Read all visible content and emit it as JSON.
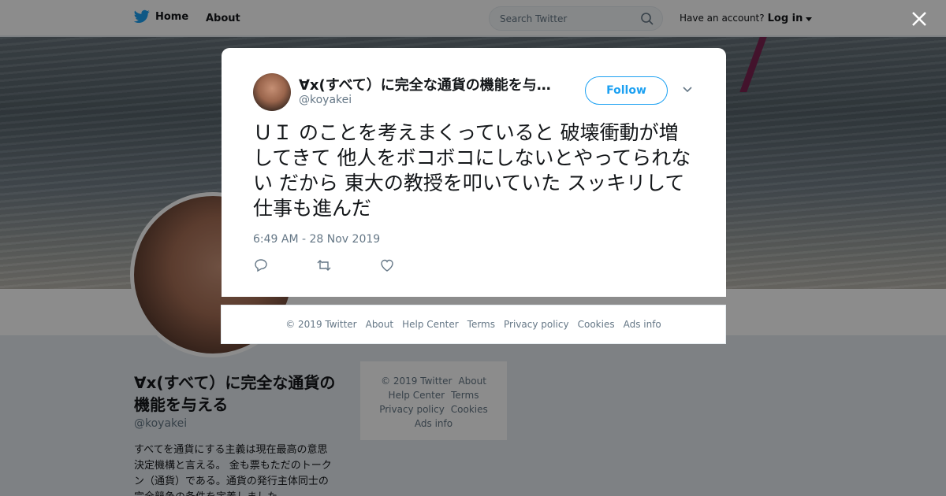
{
  "nav": {
    "home_label": "Home",
    "about_label": "About"
  },
  "search": {
    "placeholder": "Search Twitter"
  },
  "account": {
    "prompt": "Have an account?",
    "login_label": "Log in"
  },
  "profile": {
    "name": "∀x(すべて）に完全な通貨の機能を与える",
    "handle": "@koyakei",
    "bio": "すべてを通貨にする主義は現在最高の意思決定機構と言える。 金も票もただのトークン（通貨）である。通貨の発行主体同士の完全競争の条件を定義しました"
  },
  "side_footer": {
    "line1": [
      "© 2019 Twitter",
      "About"
    ],
    "line2": [
      "Help Center",
      "Terms"
    ],
    "line3": [
      "Privacy policy",
      "Cookies"
    ],
    "line4": [
      "Ads info"
    ]
  },
  "tweet": {
    "author_name": "∀x(すべて）に完全な通貨の機能を与…",
    "author_handle": "@koyakei",
    "follow_label": "Follow",
    "text": "ＵＩ のことを考えまくっていると 破壊衝動が増してきて 他人をボコボコにしないとやってられない だから 東大の教授を叩いていた スッキリして仕事も進んだ",
    "timestamp": "6:49 AM - 28 Nov 2019"
  },
  "footer_links": [
    "© 2019 Twitter",
    "About",
    "Help Center",
    "Terms",
    "Privacy policy",
    "Cookies",
    "Ads info"
  ],
  "colors": {
    "brand": "#1da1f2",
    "text": "#14171a",
    "muted": "#657786"
  }
}
